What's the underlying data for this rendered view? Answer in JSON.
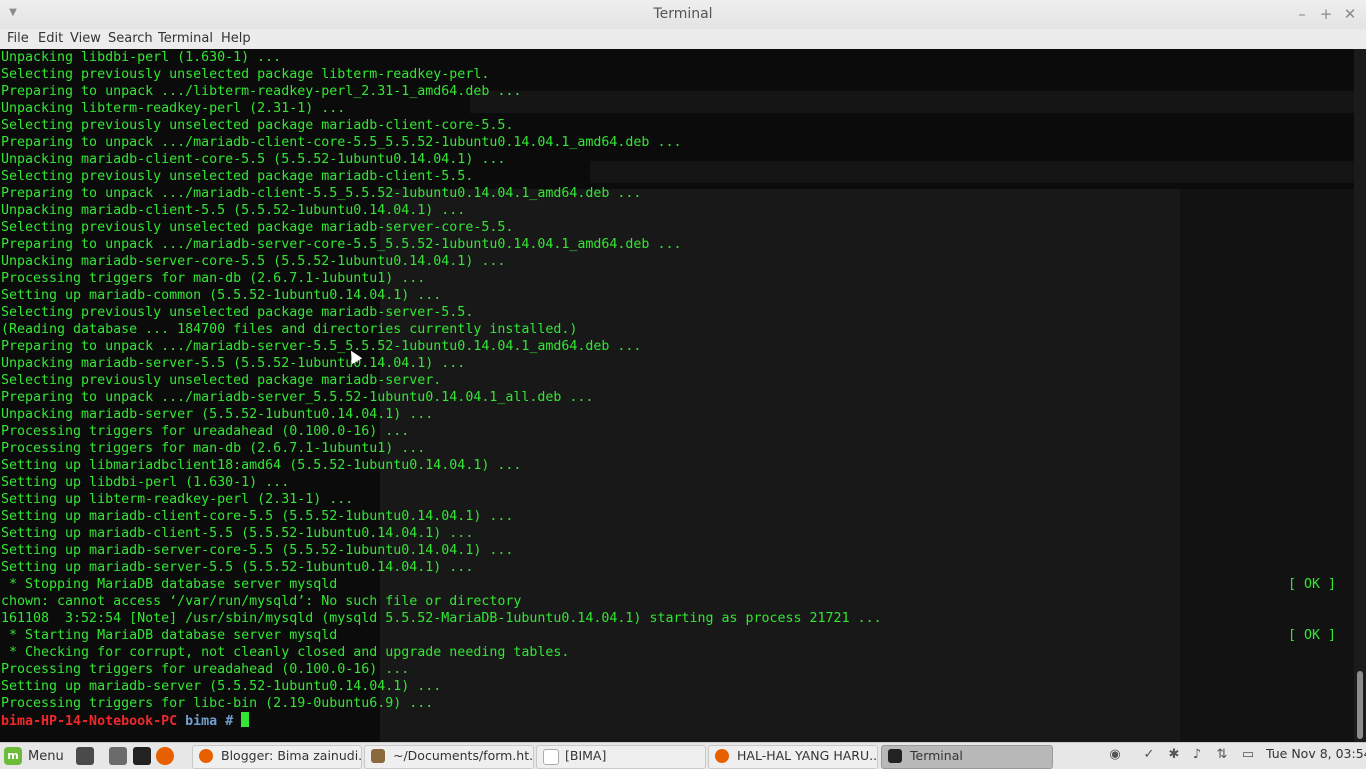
{
  "window": {
    "title": "Terminal"
  },
  "menubar": {
    "items": [
      "File",
      "Edit",
      "View",
      "Search",
      "Terminal",
      "Help"
    ]
  },
  "terminal": {
    "lines": [
      {
        "text": "Unpacking libdbi-perl (1.630-1) ...",
        "status": ""
      },
      {
        "text": "Selecting previously unselected package libterm-readkey-perl.",
        "status": ""
      },
      {
        "text": "Preparing to unpack .../libterm-readkey-perl_2.31-1_amd64.deb ...",
        "status": ""
      },
      {
        "text": "Unpacking libterm-readkey-perl (2.31-1) ...",
        "status": ""
      },
      {
        "text": "Selecting previously unselected package mariadb-client-core-5.5.",
        "status": ""
      },
      {
        "text": "Preparing to unpack .../mariadb-client-core-5.5_5.5.52-1ubuntu0.14.04.1_amd64.deb ...",
        "status": ""
      },
      {
        "text": "Unpacking mariadb-client-core-5.5 (5.5.52-1ubuntu0.14.04.1) ...",
        "status": ""
      },
      {
        "text": "Selecting previously unselected package mariadb-client-5.5.",
        "status": ""
      },
      {
        "text": "Preparing to unpack .../mariadb-client-5.5_5.5.52-1ubuntu0.14.04.1_amd64.deb ...",
        "status": ""
      },
      {
        "text": "Unpacking mariadb-client-5.5 (5.5.52-1ubuntu0.14.04.1) ...",
        "status": ""
      },
      {
        "text": "Selecting previously unselected package mariadb-server-core-5.5.",
        "status": ""
      },
      {
        "text": "Preparing to unpack .../mariadb-server-core-5.5_5.5.52-1ubuntu0.14.04.1_amd64.deb ...",
        "status": ""
      },
      {
        "text": "Unpacking mariadb-server-core-5.5 (5.5.52-1ubuntu0.14.04.1) ...",
        "status": ""
      },
      {
        "text": "Processing triggers for man-db (2.6.7.1-1ubuntu1) ...",
        "status": ""
      },
      {
        "text": "Setting up mariadb-common (5.5.52-1ubuntu0.14.04.1) ...",
        "status": ""
      },
      {
        "text": "Selecting previously unselected package mariadb-server-5.5.",
        "status": ""
      },
      {
        "text": "(Reading database ... 184700 files and directories currently installed.)",
        "status": ""
      },
      {
        "text": "Preparing to unpack .../mariadb-server-5.5_5.5.52-1ubuntu0.14.04.1_amd64.deb ...",
        "status": ""
      },
      {
        "text": "Unpacking mariadb-server-5.5 (5.5.52-1ubuntu0.14.04.1) ...",
        "status": ""
      },
      {
        "text": "Selecting previously unselected package mariadb-server.",
        "status": ""
      },
      {
        "text": "Preparing to unpack .../mariadb-server_5.5.52-1ubuntu0.14.04.1_all.deb ...",
        "status": ""
      },
      {
        "text": "Unpacking mariadb-server (5.5.52-1ubuntu0.14.04.1) ...",
        "status": ""
      },
      {
        "text": "Processing triggers for ureadahead (0.100.0-16) ...",
        "status": ""
      },
      {
        "text": "Processing triggers for man-db (2.6.7.1-1ubuntu1) ...",
        "status": ""
      },
      {
        "text": "Setting up libmariadbclient18:amd64 (5.5.52-1ubuntu0.14.04.1) ...",
        "status": ""
      },
      {
        "text": "Setting up libdbi-perl (1.630-1) ...",
        "status": ""
      },
      {
        "text": "Setting up libterm-readkey-perl (2.31-1) ...",
        "status": ""
      },
      {
        "text": "Setting up mariadb-client-core-5.5 (5.5.52-1ubuntu0.14.04.1) ...",
        "status": ""
      },
      {
        "text": "Setting up mariadb-client-5.5 (5.5.52-1ubuntu0.14.04.1) ...",
        "status": ""
      },
      {
        "text": "Setting up mariadb-server-core-5.5 (5.5.52-1ubuntu0.14.04.1) ...",
        "status": ""
      },
      {
        "text": "Setting up mariadb-server-5.5 (5.5.52-1ubuntu0.14.04.1) ...",
        "status": ""
      },
      {
        "text": " * Stopping MariaDB database server mysqld",
        "status": "[ OK ]"
      },
      {
        "text": "chown: cannot access ‘/var/run/mysqld’: No such file or directory",
        "status": ""
      },
      {
        "text": "161108  3:52:54 [Note] /usr/sbin/mysqld (mysqld 5.5.52-MariaDB-1ubuntu0.14.04.1) starting as process 21721 ...",
        "status": ""
      },
      {
        "text": " * Starting MariaDB database server mysqld",
        "status": "[ OK ]"
      },
      {
        "text": " * Checking for corrupt, not cleanly closed and upgrade needing tables.",
        "status": ""
      },
      {
        "text": "Processing triggers for ureadahead (0.100.0-16) ...",
        "status": ""
      },
      {
        "text": "Setting up mariadb-server (5.5.52-1ubuntu0.14.04.1) ...",
        "status": ""
      },
      {
        "text": "Processing triggers for libc-bin (2.19-0ubuntu6.9) ...",
        "status": ""
      }
    ],
    "prompt": {
      "user_host": "bima-HP-14-Notebook-PC",
      "dir": "bima",
      "symbol": "#"
    }
  },
  "taskbar": {
    "menu_label": "Menu",
    "tasks": [
      {
        "label": "Blogger: Bima zainudi...",
        "icon": "firefox-icon",
        "active": false
      },
      {
        "label": "~/Documents/form.ht...",
        "icon": "text-editor-icon",
        "active": false
      },
      {
        "label": "[BIMA]",
        "icon": "file-manager-icon",
        "active": false
      },
      {
        "label": "HAL-HAL YANG HARU...",
        "icon": "firefox-icon",
        "active": false
      },
      {
        "label": "Terminal",
        "icon": "terminal-icon",
        "active": true
      }
    ],
    "clock": "Tue Nov  8, 03:54"
  },
  "colors": {
    "terminal_fg": "#33e633",
    "prompt_user": "#ef2929",
    "prompt_dir": "#729fcf"
  }
}
